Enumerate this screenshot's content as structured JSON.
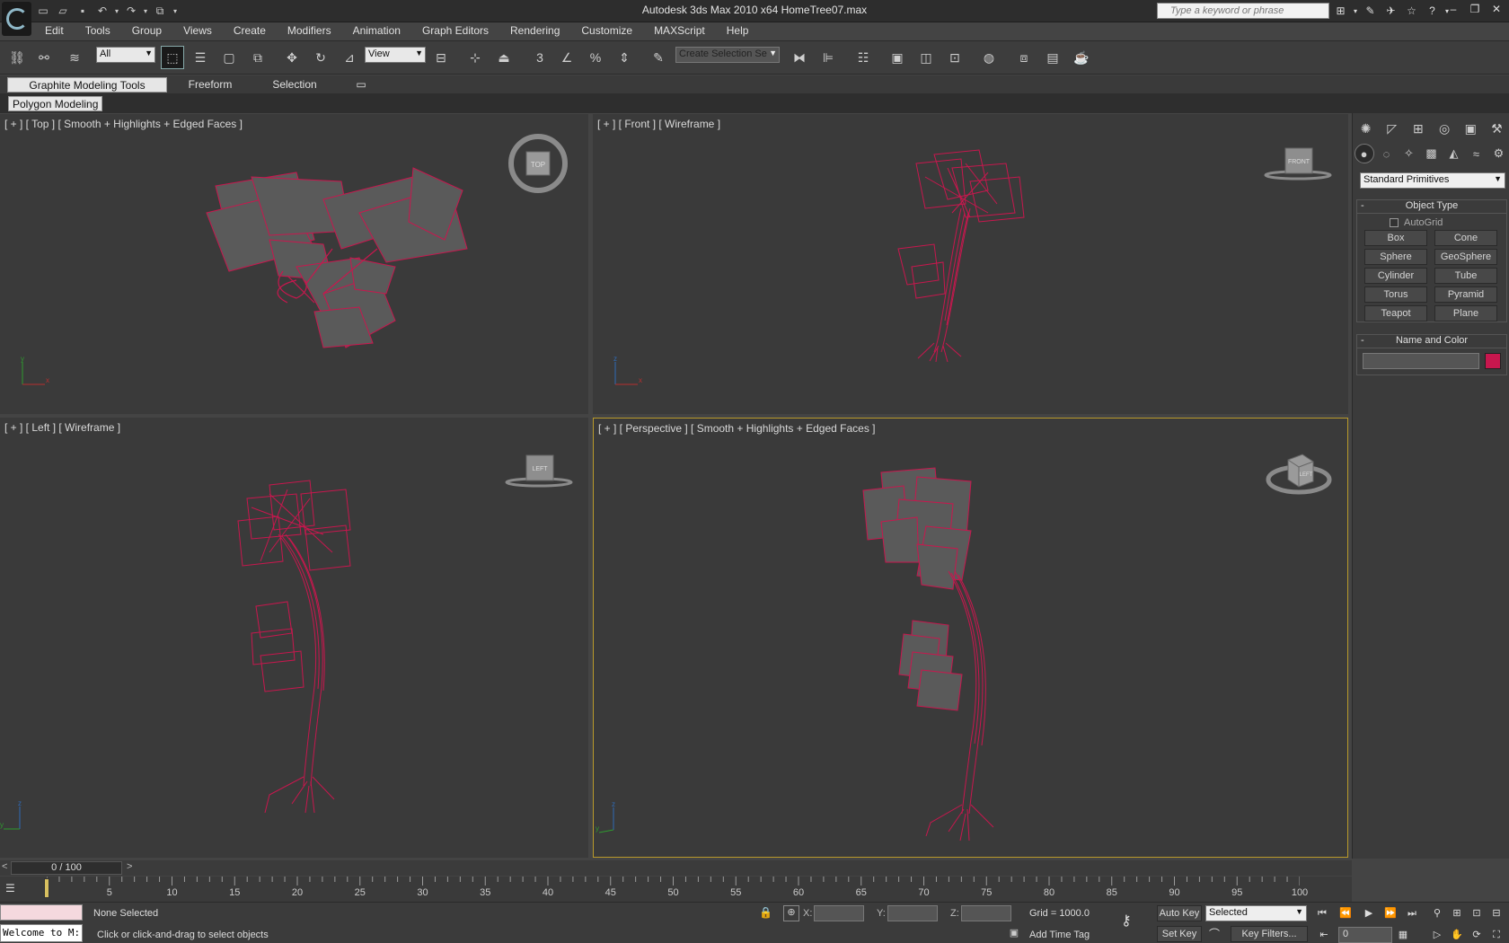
{
  "window": {
    "title": "Autodesk 3ds Max  2010 x64     HomeTree07.max",
    "search_placeholder": "Type a keyword or phrase",
    "controls": [
      "minimize",
      "restore",
      "close"
    ]
  },
  "quick_access": [
    "new-file-icon",
    "open-file-icon",
    "save-icon",
    "undo-icon",
    "redo-icon",
    "project-folder-icon"
  ],
  "info_center": [
    "binoculars-icon",
    "communication-center-icon",
    "star-icon",
    "help-icon"
  ],
  "menu": [
    "Edit",
    "Tools",
    "Group",
    "Views",
    "Create",
    "Modifiers",
    "Animation",
    "Graph Editors",
    "Rendering",
    "Customize",
    "MAXScript",
    "Help"
  ],
  "toolbar": {
    "filter_value": "All",
    "ref_coord_value": "View",
    "snap_label": "3",
    "selection_set_placeholder": "Create Selection Se"
  },
  "ribbon": {
    "tabs": [
      "Graphite Modeling Tools",
      "Freeform",
      "Selection"
    ],
    "active_tab": "Graphite Modeling Tools",
    "panel_label": "Polygon Modeling"
  },
  "viewports": {
    "top": {
      "label": "[ + ] [ Top ] [ Smooth + Highlights + Edged Faces ]",
      "cube": "TOP"
    },
    "front": {
      "label": "[ + ] [ Front ] [ Wireframe ]",
      "cube": "FRONT"
    },
    "left": {
      "label": "[ + ] [ Left ] [ Wireframe ]",
      "cube": "LEFT"
    },
    "perspective": {
      "label": "[ + ] [ Perspective ] [ Smooth + Highlights + Edged Faces ]",
      "cube": "LEFT"
    },
    "object_color": "#c8174e",
    "viewport_bg": "#3a3a3a",
    "active_border": "#b99a2a"
  },
  "command_panel": {
    "dropdown": "Standard Primitives",
    "object_type": {
      "title": "Object Type",
      "autogrid": "AutoGrid",
      "buttons": [
        "Box",
        "Cone",
        "Sphere",
        "GeoSphere",
        "Cylinder",
        "Tube",
        "Torus",
        "Pyramid",
        "Teapot",
        "Plane"
      ]
    },
    "name_color": {
      "title": "Name and Color",
      "name_value": "",
      "color": "#c8174e"
    }
  },
  "time_slider": {
    "value": "0 / 100",
    "prev": "<",
    "next": ">",
    "ticks": [
      "0",
      "5",
      "10",
      "15",
      "20",
      "25",
      "30",
      "35",
      "40",
      "45",
      "50",
      "55",
      "60",
      "65",
      "70",
      "75",
      "80",
      "85",
      "90",
      "95",
      "100"
    ]
  },
  "status": {
    "maxscript": "Welcome to M:",
    "selection": "None Selected",
    "prompt": "Click or click-and-drag to select objects",
    "x_label": "X:",
    "y_label": "Y:",
    "z_label": "Z:",
    "grid": "Grid = 1000.0",
    "add_time_tag": "Add Time Tag",
    "auto_key": "Auto Key",
    "set_key": "Set Key",
    "selected_value": "Selected",
    "key_filters": "Key Filters...",
    "frame_value": "0"
  }
}
